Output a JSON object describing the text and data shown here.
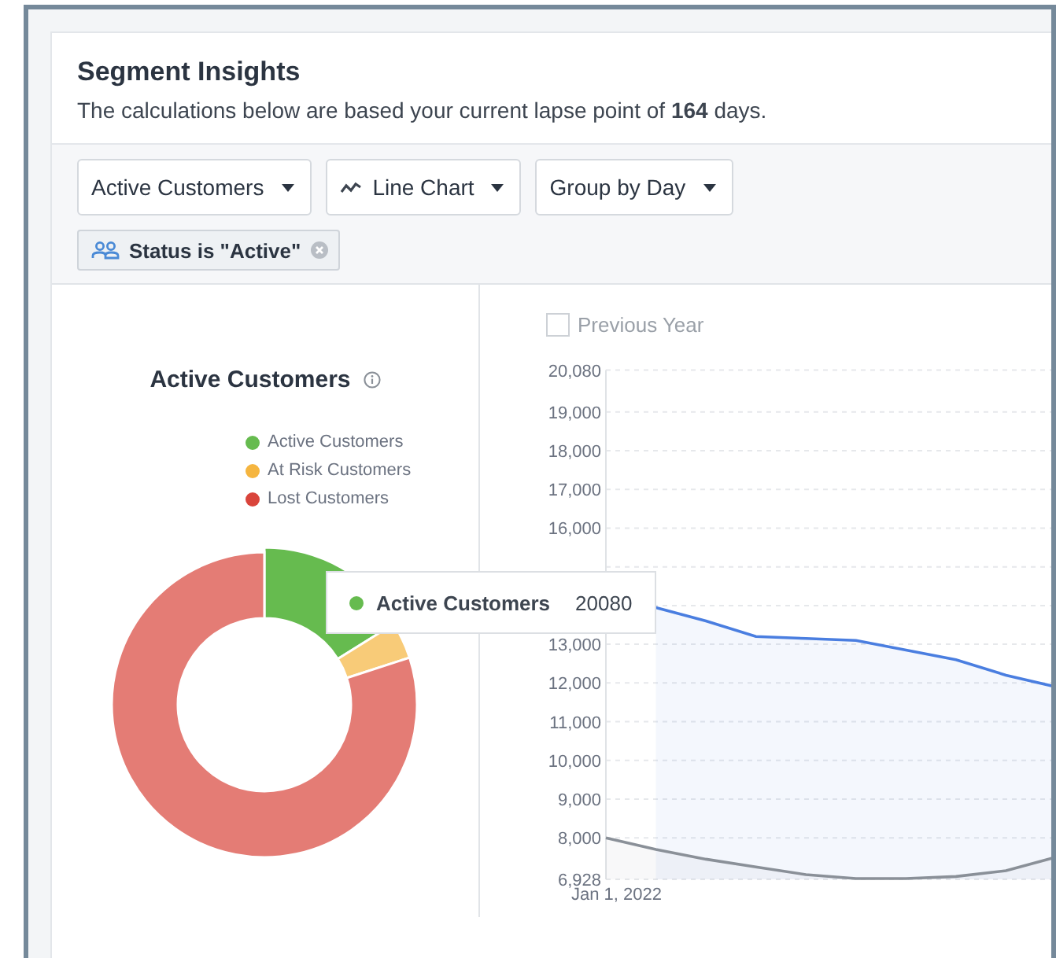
{
  "header": {
    "title": "Segment Insights",
    "subtitle": "The calculations below are based your current lapse point of **164** days."
  },
  "dropdowns": [
    {
      "label": "Active Customers",
      "kind": "plain"
    },
    {
      "label": "Line Chart",
      "kind": "icon"
    },
    {
      "label": "Group by Day",
      "kind": "plain"
    }
  ],
  "filter_chip": {
    "label": "Status is \"Active\""
  },
  "donut_panel": {
    "title": "Active Customers",
    "legend": [
      {
        "label": "Active Customers",
        "color": "#66bb4f"
      },
      {
        "label": "At Risk Customers",
        "color": "#f5b53f"
      },
      {
        "label": "Lost Customers",
        "color": "#d9443b"
      }
    ]
  },
  "tooltip": {
    "label": "Active Customers",
    "value": "20080"
  },
  "previous_year": {
    "label": "Previous Year",
    "checked": false
  },
  "line_panel": {
    "chart_data": {
      "type": "area",
      "xlabel": "Jan 1, 2022",
      "grid": true,
      "ylim": [
        6928,
        20080
      ],
      "yticks": [
        {
          "value": 6928,
          "label": "6,928"
        },
        {
          "value": 8000,
          "label": "8,000"
        },
        {
          "value": 9000,
          "label": "9,000"
        },
        {
          "value": 10000,
          "label": "10,000"
        },
        {
          "value": 11000,
          "label": "11,000"
        },
        {
          "value": 12000,
          "label": "12,000"
        },
        {
          "value": 13000,
          "label": "13,000"
        },
        {
          "value": 16000,
          "label": "16,000"
        },
        {
          "value": 17000,
          "label": "17,000"
        },
        {
          "value": 18000,
          "label": "18,000"
        },
        {
          "value": 19000,
          "label": "19,000"
        },
        {
          "value": 20080,
          "label": "20,080"
        }
      ],
      "series": [
        {
          "color": "#4a7ee0",
          "values": [
            null,
            13950,
            13600,
            13200,
            13150,
            13100,
            12850,
            12600,
            12200,
            11900
          ]
        },
        {
          "color": "#8a9098",
          "values": [
            8000,
            7700,
            7450,
            7250,
            7050,
            6950,
            6950,
            7000,
            7150,
            7500
          ]
        }
      ]
    }
  }
}
